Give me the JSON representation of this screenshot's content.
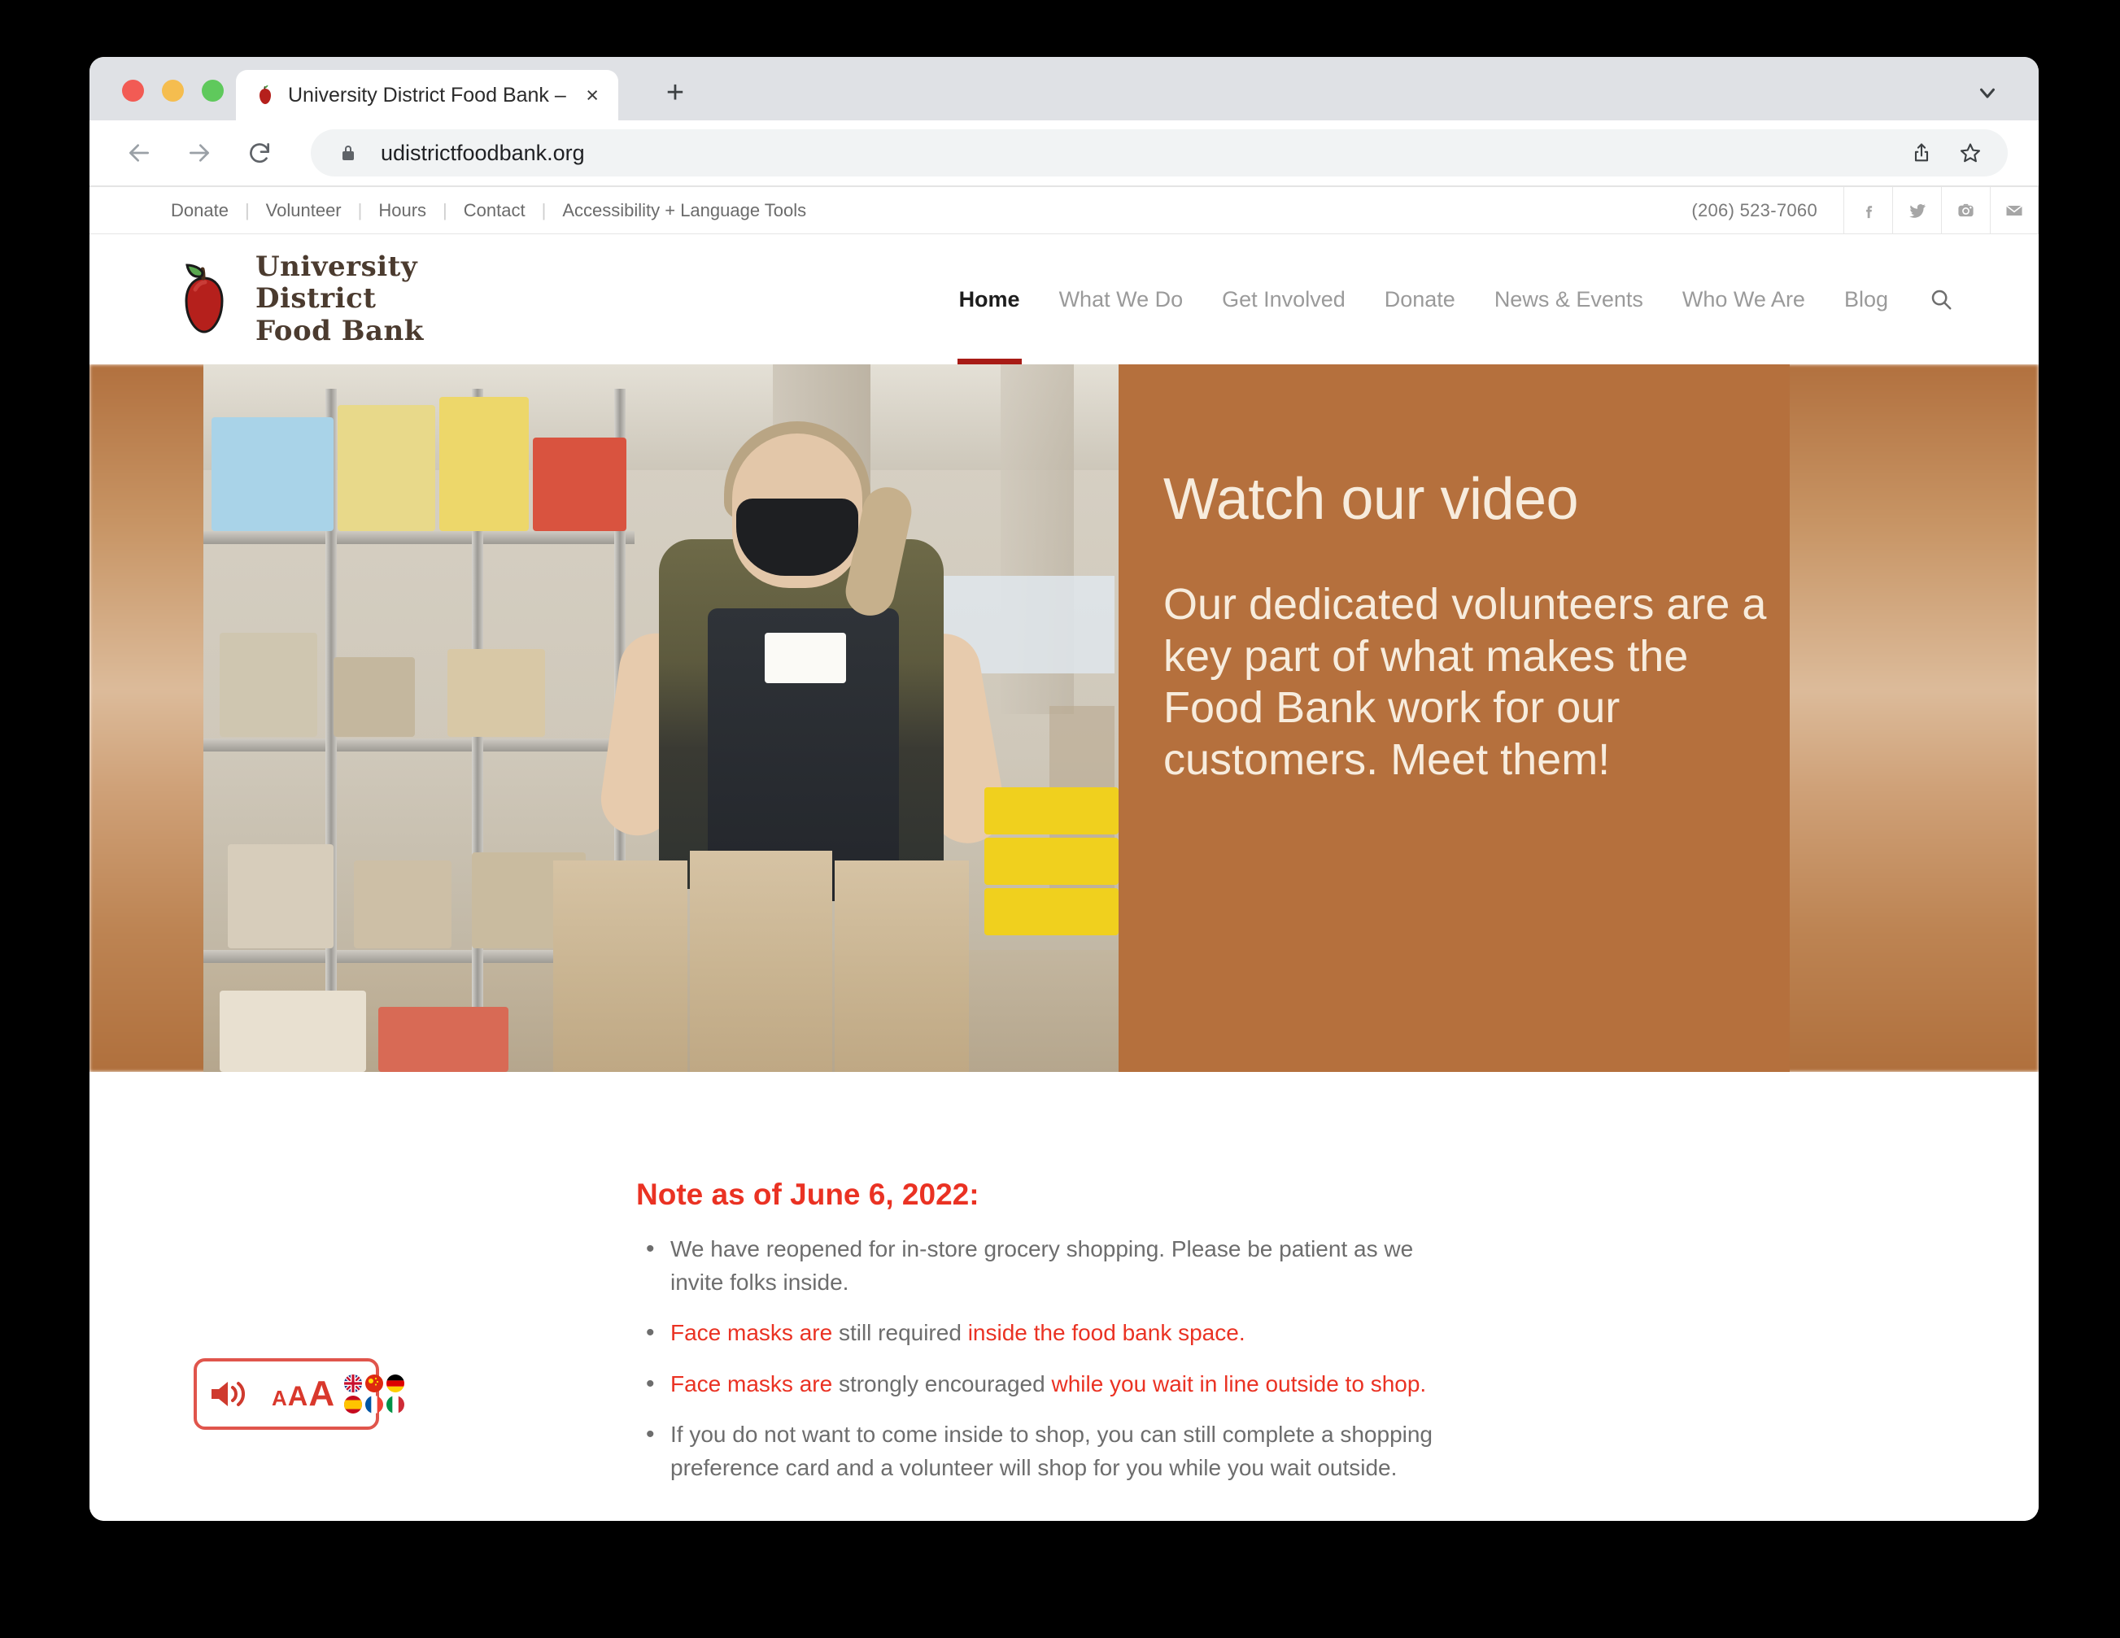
{
  "browser": {
    "tab": {
      "title": "University District Food Bank –",
      "favicon": "apple-icon",
      "close": "×"
    },
    "newtab_label": "+",
    "tablist_chevron": "chevron-down-icon",
    "toolbar": {
      "back": "back-arrow-icon",
      "forward": "forward-arrow-icon",
      "reload": "reload-icon",
      "lock": "lock-icon",
      "url": "udistrictfoodbank.org",
      "share": "share-icon",
      "bookmark": "star-icon"
    }
  },
  "site": {
    "utility_nav": [
      {
        "label": "Donate"
      },
      {
        "label": "Volunteer"
      },
      {
        "label": "Hours"
      },
      {
        "label": "Contact"
      },
      {
        "label": "Accessibility + Language Tools"
      }
    ],
    "phone": "(206) 523-7060",
    "social": [
      {
        "name": "facebook-icon"
      },
      {
        "name": "twitter-icon"
      },
      {
        "name": "instagram-icon"
      },
      {
        "name": "email-icon"
      }
    ],
    "logo": {
      "line1": "University",
      "line2": "District",
      "line3": "Food Bank"
    },
    "main_nav": [
      {
        "label": "Home",
        "active": true
      },
      {
        "label": "What We Do",
        "active": false
      },
      {
        "label": "Get Involved",
        "active": false
      },
      {
        "label": "Donate",
        "active": false
      },
      {
        "label": "News & Events",
        "active": false
      },
      {
        "label": "Who We Are",
        "active": false
      },
      {
        "label": "Blog",
        "active": false
      }
    ],
    "search_icon": "search-icon",
    "hero": {
      "title": "Watch our video",
      "subtitle": "Our dedicated volunteers are a key part of what makes the Food Bank work for our customers. Meet them!",
      "photo_alt": "volunteer-packing-grocery-bags-photo",
      "panel_color": "#b5703d",
      "text_color": "#f7ecdd"
    },
    "notice": {
      "title": "Note as of June 6, 2022:",
      "title_color": "#ea3223",
      "bullets": [
        {
          "parts": [
            {
              "text": "We have reopened for in-store grocery shopping. Please be patient as we invite folks inside.",
              "color": "gray"
            }
          ]
        },
        {
          "parts": [
            {
              "text": "Face masks are ",
              "color": "red"
            },
            {
              "text": "still required ",
              "color": "gray"
            },
            {
              "text": "inside the food bank space.",
              "color": "red"
            }
          ]
        },
        {
          "parts": [
            {
              "text": "Face masks are ",
              "color": "red"
            },
            {
              "text": "strongly encouraged ",
              "color": "gray"
            },
            {
              "text": "while you wait in line outside to shop.",
              "color": "red"
            }
          ]
        },
        {
          "parts": [
            {
              "text": "If you do not want to come inside to shop, you can still complete a shopping preference card and a volunteer will shop for you while you wait outside.",
              "color": "gray"
            }
          ]
        }
      ]
    },
    "a11y_widget": {
      "speaker": "speaker-icon",
      "text_sizes": [
        "A",
        "A",
        "A"
      ],
      "accent_color": "#d9382c",
      "flags": [
        {
          "name": "flag-uk"
        },
        {
          "name": "flag-china"
        },
        {
          "name": "flag-germany"
        },
        {
          "name": "flag-spain"
        },
        {
          "name": "flag-france"
        },
        {
          "name": "flag-italy"
        }
      ]
    }
  }
}
